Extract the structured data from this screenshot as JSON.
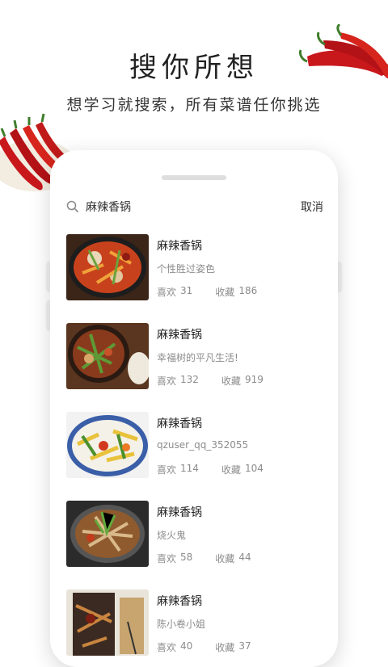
{
  "promo": {
    "headline": "搜你所想",
    "subline": "想学习就搜索，所有菜谱任你挑选"
  },
  "search": {
    "query": "麻辣香锅",
    "cancel_label": "取消"
  },
  "results": [
    {
      "title": "麻辣香锅",
      "author": "个性胜过姿色",
      "likes_label": "喜欢",
      "likes": "31",
      "favorites_label": "收藏",
      "favorites": "186"
    },
    {
      "title": "麻辣香锅",
      "author": "幸福树的平凡生活!",
      "likes_label": "喜欢",
      "likes": "132",
      "favorites_label": "收藏",
      "favorites": "919"
    },
    {
      "title": "麻辣香锅",
      "author": "qzuser_qq_352055",
      "likes_label": "喜欢",
      "likes": "114",
      "favorites_label": "收藏",
      "favorites": "104"
    },
    {
      "title": "麻辣香锅",
      "author": "烧火鬼",
      "likes_label": "喜欢",
      "likes": "58",
      "favorites_label": "收藏",
      "favorites": "44"
    },
    {
      "title": "麻辣香锅",
      "author": "陈小卷小姐",
      "likes_label": "喜欢",
      "likes": "40",
      "favorites_label": "收藏",
      "favorites": "37"
    }
  ],
  "icons": {
    "search": "search-icon",
    "pepper": "chili-pepper-icon"
  },
  "colors": {
    "pepper_red": "#c8181c",
    "pepper_stem": "#3e7d2a",
    "text_secondary": "#8c8c8c"
  }
}
